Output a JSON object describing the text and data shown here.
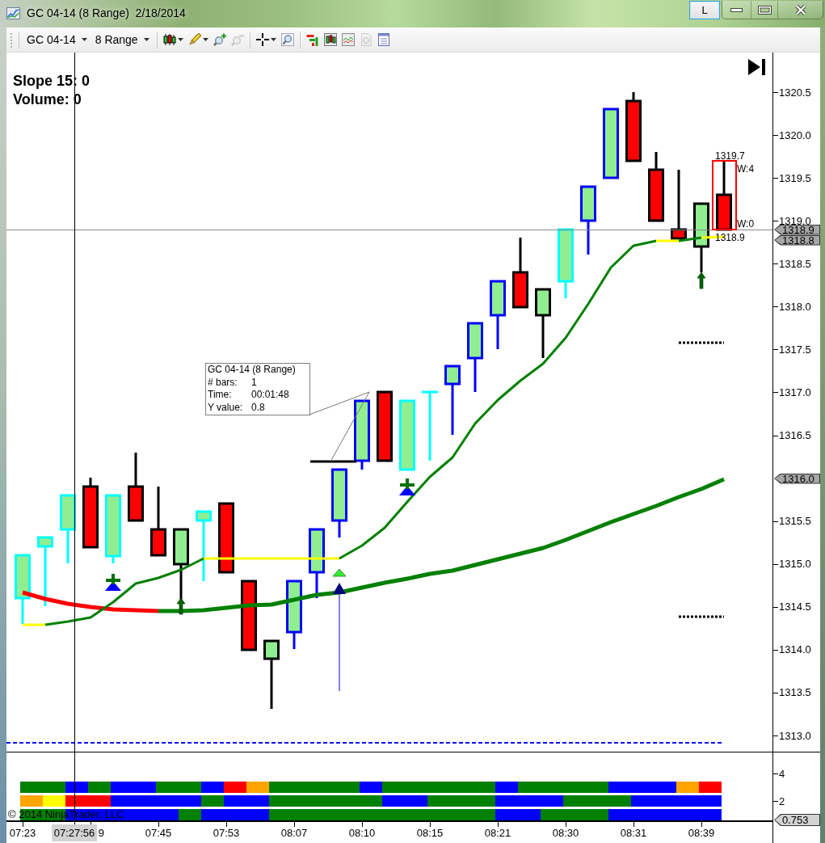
{
  "window": {
    "title": "GC 04-14 (8 Range)  2/18/2014",
    "layout_button": "L"
  },
  "toolbar": {
    "selectors": [
      "GC 04-14",
      "8 Range"
    ],
    "tool_groups": [
      {
        "tools": [
          {
            "dropdown": true,
            "disabled": false
          },
          {
            "dropdown": true,
            "disabled": false
          },
          {
            "dropdown": false,
            "disabled": false
          },
          {
            "dropdown": false,
            "disabled": true
          }
        ]
      },
      {
        "tools": [
          {
            "dropdown": true,
            "disabled": false
          },
          {
            "dropdown": false,
            "disabled": false
          }
        ]
      },
      {
        "tools": [
          {
            "dropdown": false,
            "disabled": false
          },
          {
            "dropdown": false,
            "disabled": false
          },
          {
            "dropdown": false,
            "disabled": false
          },
          {
            "dropdown": false,
            "disabled": true
          },
          {
            "dropdown": false,
            "disabled": false
          }
        ]
      }
    ]
  },
  "price_panel": {
    "readouts": [
      "Slope 15: 0",
      "Volume: 0"
    ],
    "tooltip": {
      "title": "GC 04-14 (8 Range)",
      "rows": [
        {
          "label": "# bars:",
          "value": "1"
        },
        {
          "label": "Time:",
          "value": "00:01:48"
        },
        {
          "label": "Y value:",
          "value": "0.8"
        }
      ]
    },
    "annotations": [
      "1319.7",
      "W:4",
      "W:0",
      "1318.9"
    ]
  },
  "price_axis": {
    "ticks": [
      "1320.5",
      "1320.0",
      "1319.5",
      "1319.0",
      "1318.5",
      "1318.0",
      "1317.5",
      "1317.0",
      "1316.5",
      "1315.5",
      "1315.0",
      "1314.5",
      "1314.0",
      "1313.5",
      "1313.0"
    ],
    "tags": [
      "1318.9",
      "1318.8",
      "1316.0"
    ]
  },
  "indicator_panel": {
    "rows": [
      {
        "blocks": [
          {
            "color": "#008000"
          },
          {
            "color": "#008000"
          },
          {
            "color": "#0000ff"
          },
          {
            "color": "#008000"
          },
          {
            "color": "#0000ff"
          },
          {
            "color": "#0000ff"
          },
          {
            "color": "#008000"
          },
          {
            "color": "#008000"
          },
          {
            "color": "#0000ff"
          },
          {
            "color": "#ff0000"
          },
          {
            "color": "#ffa500"
          },
          {
            "color": "#008000"
          },
          {
            "color": "#008000"
          },
          {
            "color": "#008000"
          },
          {
            "color": "#008000"
          },
          {
            "color": "#0000ff"
          },
          {
            "color": "#008000"
          },
          {
            "color": "#008000"
          },
          {
            "color": "#008000"
          },
          {
            "color": "#008000"
          },
          {
            "color": "#008000"
          },
          {
            "color": "#0000ff"
          },
          {
            "color": "#008000"
          },
          {
            "color": "#008000"
          },
          {
            "color": "#008000"
          },
          {
            "color": "#008000"
          },
          {
            "color": "#0000ff"
          },
          {
            "color": "#0000ff"
          },
          {
            "color": "#0000ff"
          },
          {
            "color": "#ffa500"
          },
          {
            "color": "#ff0000"
          }
        ]
      },
      {
        "blocks": [
          {
            "color": "#ffa500"
          },
          {
            "color": "#ffff00"
          },
          {
            "color": "#ff0000"
          },
          {
            "color": "#ff0000"
          },
          {
            "color": "#0000ff"
          },
          {
            "color": "#0000ff"
          },
          {
            "color": "#0000ff"
          },
          {
            "color": "#0000ff"
          },
          {
            "color": "#008000"
          },
          {
            "color": "#0000ff"
          },
          {
            "color": "#0000ff"
          },
          {
            "color": "#008000"
          },
          {
            "color": "#008000"
          },
          {
            "color": "#008000"
          },
          {
            "color": "#008000"
          },
          {
            "color": "#008000"
          },
          {
            "color": "#0000ff"
          },
          {
            "color": "#0000ff"
          },
          {
            "color": "#008000"
          },
          {
            "color": "#008000"
          },
          {
            "color": "#008000"
          },
          {
            "color": "#0000ff"
          },
          {
            "color": "#0000ff"
          },
          {
            "color": "#0000ff"
          },
          {
            "color": "#008000"
          },
          {
            "color": "#008000"
          },
          {
            "color": "#008000"
          },
          {
            "color": "#0000ff"
          },
          {
            "color": "#0000ff"
          },
          {
            "color": "#0000ff"
          },
          {
            "color": "#0000ff"
          }
        ]
      },
      {
        "blocks": [
          {
            "color": "#008000"
          },
          {
            "color": "#008000"
          },
          {
            "color": "#0000ff"
          },
          {
            "color": "#0000ff"
          },
          {
            "color": "#0000ff"
          },
          {
            "color": "#0000ff"
          },
          {
            "color": "#0000ff"
          },
          {
            "color": "#008000"
          },
          {
            "color": "#0000ff"
          },
          {
            "color": "#0000ff"
          },
          {
            "color": "#0000ff"
          },
          {
            "color": "#008000"
          },
          {
            "color": "#008000"
          },
          {
            "color": "#008000"
          },
          {
            "color": "#008000"
          },
          {
            "color": "#008000"
          },
          {
            "color": "#008000"
          },
          {
            "color": "#008000"
          },
          {
            "color": "#008000"
          },
          {
            "color": "#008000"
          },
          {
            "color": "#008000"
          },
          {
            "color": "#0000ff"
          },
          {
            "color": "#0000ff"
          },
          {
            "color": "#008000"
          },
          {
            "color": "#008000"
          },
          {
            "color": "#008000"
          },
          {
            "color": "#0000ff"
          },
          {
            "color": "#0000ff"
          },
          {
            "color": "#0000ff"
          },
          {
            "color": "#0000ff"
          },
          {
            "color": "#0000ff"
          }
        ]
      }
    ],
    "copyright": "© 2014 NinjaTrader, LLC",
    "axis_ticks": [
      "4",
      "2"
    ],
    "axis_tag": "0.753"
  },
  "time_axis": {
    "labels": [
      {
        "text": "07:23",
        "clipped": false
      },
      {
        "text": "9",
        "clipped": true
      },
      {
        "text": "07:45",
        "clipped": false
      },
      {
        "text": "07:53",
        "clipped": false
      },
      {
        "text": "08:07",
        "clipped": false
      },
      {
        "text": "08:10",
        "clipped": false
      },
      {
        "text": "08:15",
        "clipped": false
      },
      {
        "text": "08:21",
        "clipped": false
      },
      {
        "text": "08:30",
        "clipped": false
      },
      {
        "text": "08:31",
        "clipped": false
      },
      {
        "text": "08:39",
        "clipped": false
      }
    ],
    "cursor_label": "07:27:56"
  }
}
